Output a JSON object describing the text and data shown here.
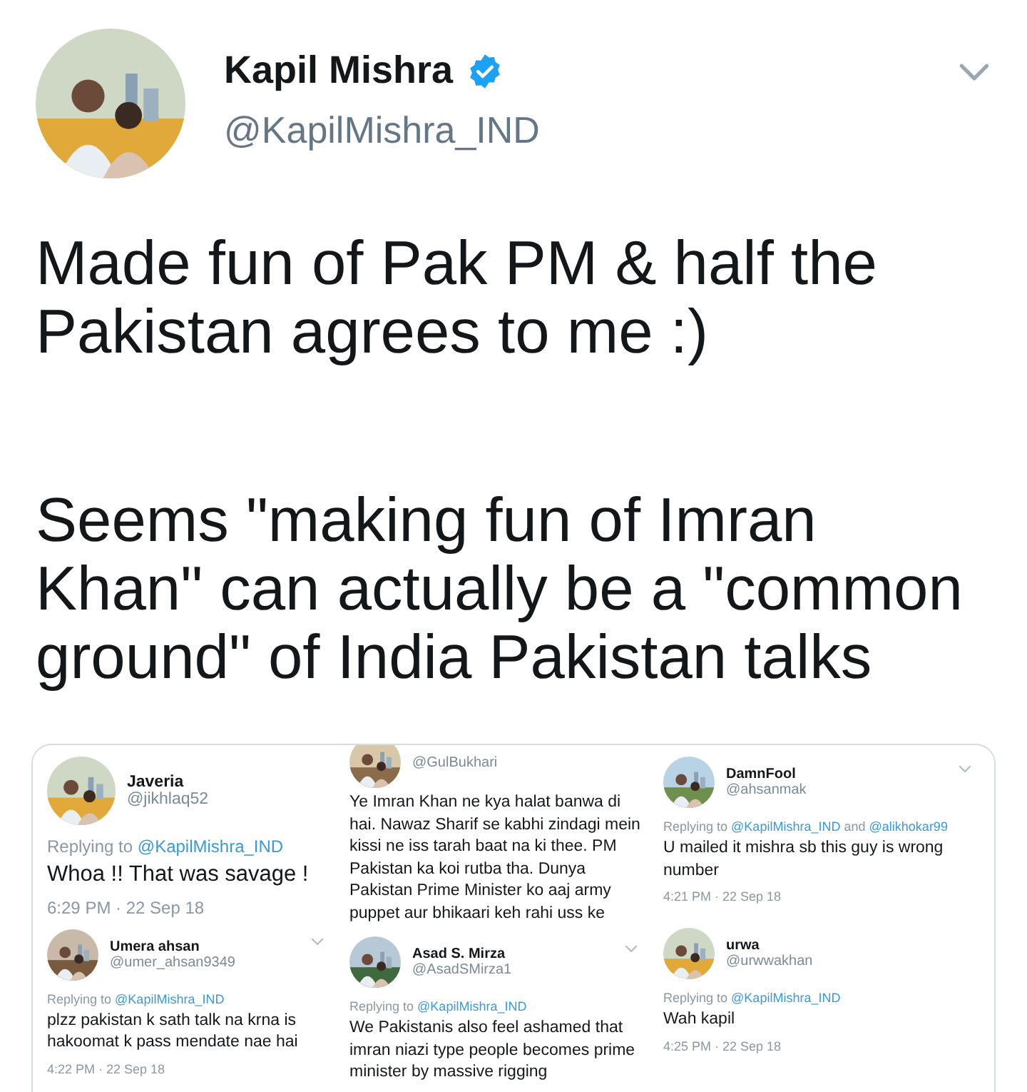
{
  "author": {
    "name": "Kapil Mishra",
    "verified": true,
    "handle": "@KapilMishra_IND"
  },
  "paragraphs": [
    "Made fun of Pak PM & half the\nPakistan agrees to me :)",
    "Seems \"making fun of Imran\nKhan\" can actually be a \"common\nground\" of India Pakistan talks"
  ],
  "attachment": {
    "columns": [
      {
        "tweets": [
          {
            "kind": "large",
            "name": "Javeria",
            "handle": "@jikhlaq52",
            "has_menu": false,
            "reply": [
              {
                "kind": "plain",
                "text": "Replying to"
              },
              {
                "kind": "mention",
                "text": "@KapilMishra_IND"
              }
            ],
            "body": "Whoa !! That was savage !",
            "time": "6:29 PM · 22 Sep 18"
          },
          {
            "kind": "regular",
            "name": "Umera ahsan",
            "handle": "@umer_ahsan9349",
            "has_menu": true,
            "reply": [
              {
                "kind": "plain",
                "text": "Replying to"
              },
              {
                "kind": "mention",
                "text": "@KapilMishra_IND"
              }
            ],
            "body": "plzz pakistan k sath talk na krna is hakoomat k pass mendate nae hai",
            "time": "4:22 PM · 22 Sep 18"
          }
        ]
      },
      {
        "tweets": [
          {
            "kind": "cut",
            "handle": "@GulBukhari",
            "has_menu": false,
            "body": "Ye Imran Khan ne kya halat banwa di hai. Nawaz Sharif se kabhi zindagi mein kissi ne iss tarah baat na ki thee. PM Pakistan ka koi rutba tha. Dunya Pakistan Prime Minister ko aaj army puppet aur bhikaari keh rahi uss ke"
          },
          {
            "kind": "regular",
            "name": "Asad S. Mirza",
            "handle": "@AsadSMirza1",
            "has_menu": true,
            "reply": [
              {
                "kind": "plain",
                "text": "Replying to"
              },
              {
                "kind": "mention",
                "text": "@KapilMishra_IND"
              }
            ],
            "body": "We Pakistanis also feel ashamed that imran niazi type people becomes prime minister by massive rigging"
          }
        ]
      },
      {
        "tweets": [
          {
            "kind": "regular",
            "name": "DamnFool",
            "handle": "@ahsanmak",
            "has_menu": true,
            "reply": [
              {
                "kind": "plain",
                "text": "Replying to"
              },
              {
                "kind": "mention",
                "text": "@KapilMishra_IND"
              },
              {
                "kind": "plain",
                "text": "and"
              },
              {
                "kind": "mention",
                "text": "@alikhokar99"
              }
            ],
            "body": "U mailed it mishra sb this guy is wrong number",
            "time": "4:21 PM · 22 Sep 18"
          },
          {
            "kind": "regular",
            "name": "urwa",
            "handle": "@urwwakhan",
            "has_menu": false,
            "reply": [
              {
                "kind": "plain",
                "text": "Replying to"
              },
              {
                "kind": "mention",
                "text": "@KapilMishra_IND"
              }
            ],
            "body": "Wah kapil",
            "time": "4:25 PM · 22 Sep 18"
          }
        ]
      }
    ]
  }
}
